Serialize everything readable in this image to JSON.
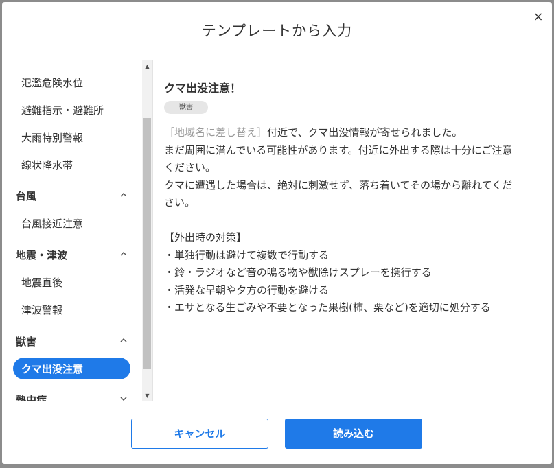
{
  "dialog": {
    "title": "テンプレートから入力",
    "close_symbol": "×"
  },
  "sidebar": {
    "items": [
      {
        "kind": "item",
        "label": "氾濫危険水位"
      },
      {
        "kind": "item",
        "label": "避難指示・避難所"
      },
      {
        "kind": "item",
        "label": "大雨特別警報"
      },
      {
        "kind": "item",
        "label": "線状降水帯"
      },
      {
        "kind": "category",
        "label": "台風",
        "expanded": true
      },
      {
        "kind": "item",
        "label": "台風接近注意"
      },
      {
        "kind": "category",
        "label": "地震・津波",
        "expanded": true
      },
      {
        "kind": "item",
        "label": "地震直後"
      },
      {
        "kind": "item",
        "label": "津波警報"
      },
      {
        "kind": "category",
        "label": "獣害",
        "expanded": true
      },
      {
        "kind": "item",
        "label": "クマ出没注意",
        "selected": true
      },
      {
        "kind": "category",
        "label": "熱中症",
        "expanded": false
      }
    ]
  },
  "template": {
    "title": "クマ出没注意！",
    "tag": "獣害",
    "placeholder": "［地域名に差し替え］",
    "body_line1_rest": "付近で、クマ出没情報が寄せられました。",
    "body_lines": [
      "まだ周囲に潜んでいる可能性があります。付近に外出する際は十分にご注意",
      "ください。",
      "クマに遭遇した場合は、絶対に刺激せず、落ち着いてその場から離れてくだ",
      "さい。",
      "",
      "【外出時の対策】",
      "・単独行動は避けて複数で行動する",
      "・鈴・ラジオなど音の鳴る物や獣除けスプレーを携行する",
      "・活発な早朝や夕方の行動を避ける",
      "・エサとなる生ごみや不要となった果樹(柿、栗など)を適切に処分する"
    ]
  },
  "footer": {
    "cancel_label": "キャンセル",
    "load_label": "読み込む"
  },
  "colors": {
    "accent": "#1f7ae8",
    "tag_background": "#e6e6e6",
    "placeholder_text": "#9a9a9a",
    "overlay": "#8c8c8c"
  }
}
